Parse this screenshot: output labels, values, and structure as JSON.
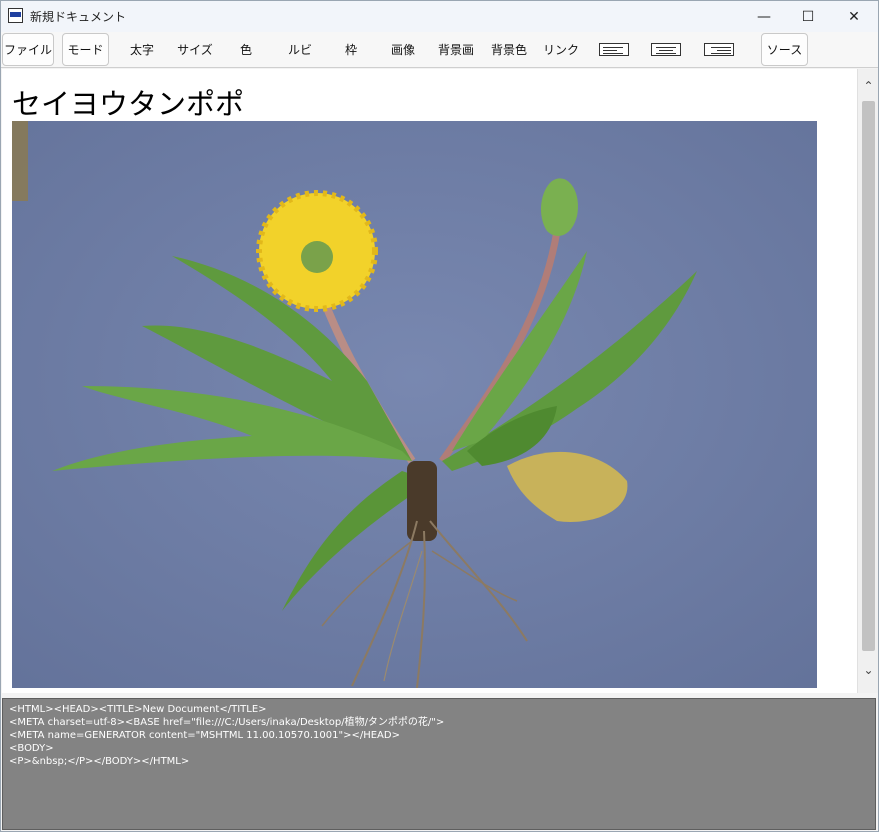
{
  "window": {
    "title": "新規ドキュメント",
    "controls": {
      "minimize": "—",
      "maximize": "☐",
      "close": "✕"
    }
  },
  "toolbar": {
    "file": "ファイル",
    "mode": "モード",
    "bold": "太字",
    "size": "サイズ",
    "color": "色",
    "ruby": "ルビ",
    "frame": "枠",
    "image": "画像",
    "bg_image": "背景画",
    "bg_color": "背景色",
    "link": "リンク",
    "align_icons": [
      "align-left-icon",
      "align-center-icon",
      "align-right-icon"
    ],
    "source": "ソース"
  },
  "document": {
    "heading": "セイヨウタンポポ",
    "image_subject": "dandelion plant with roots on blue background"
  },
  "scrollbar": {
    "up": "⌃",
    "down": "⌄"
  },
  "source_view": {
    "lines": [
      "<HTML><HEAD><TITLE>New Document</TITLE>",
      "<META charset=utf-8><BASE href=\"file:///C:/Users/inaka/Desktop/植物/タンポポの花/\">",
      "<META name=GENERATOR content=\"MSHTML 11.00.10570.1001\"></HEAD>",
      "<BODY>",
      "<P>&nbsp;</P></BODY></HTML>"
    ]
  },
  "colors": {
    "photo_background": "#6f7fa8",
    "flower": "#f2d22a",
    "leaf": "#5f9a3e",
    "source_bg": "#838383"
  }
}
